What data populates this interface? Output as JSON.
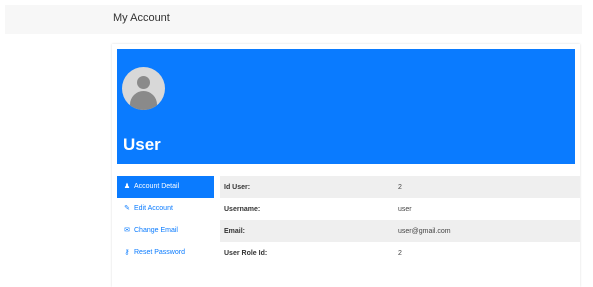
{
  "header": {
    "title": "My Account"
  },
  "profile": {
    "name": "User"
  },
  "menu": {
    "items": [
      {
        "icon": "user-icon",
        "label": "Account Detail",
        "active": true
      },
      {
        "icon": "edit-icon",
        "label": "Edit Account",
        "active": false
      },
      {
        "icon": "envelope-icon",
        "label": "Change Email",
        "active": false
      },
      {
        "icon": "key-icon",
        "label": "Reset Password",
        "active": false
      }
    ]
  },
  "details": {
    "rows": [
      {
        "label": "Id User:",
        "value": "2"
      },
      {
        "label": "Username:",
        "value": "user"
      },
      {
        "label": "Email:",
        "value": "user@gmail.com"
      },
      {
        "label": "User Role Id:",
        "value": "2"
      }
    ]
  },
  "colors": {
    "accent": "#0a7bff",
    "row_stripe": "#efefef",
    "topbar": "#f7f7f7"
  }
}
